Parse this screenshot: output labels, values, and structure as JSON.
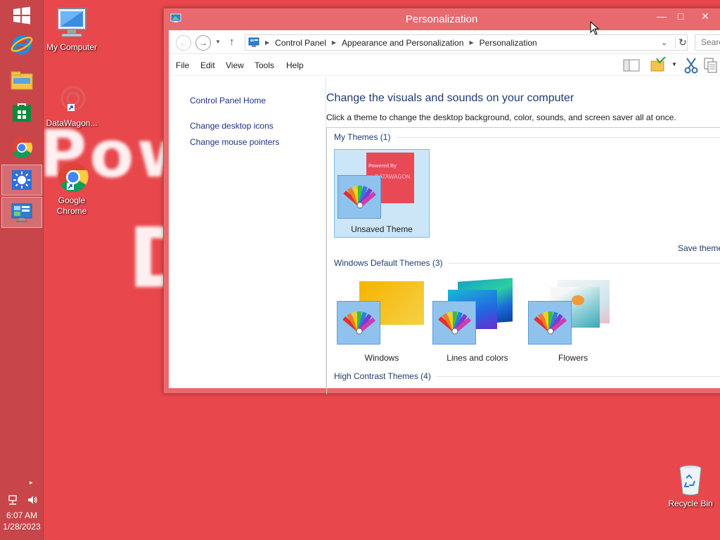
{
  "window": {
    "title": "Personalization",
    "minimize_glyph": "—",
    "maximize_glyph": "□",
    "close_glyph": "✕"
  },
  "address": {
    "crumbs": [
      "Control Panel",
      "Appearance and Personalization",
      "Personalization"
    ],
    "search_placeholder": "Search"
  },
  "menu": [
    "File",
    "Edit",
    "View",
    "Tools",
    "Help"
  ],
  "left_pane": {
    "home": "Control Panel Home",
    "links": [
      "Change desktop icons",
      "Change mouse pointers"
    ]
  },
  "main": {
    "heading": "Change the visuals and sounds on your computer",
    "subtext": "Click a theme to change the desktop background, color, sounds, and screen saver all at once.",
    "groups": [
      {
        "title": "My Themes (1)"
      },
      {
        "title": "Windows Default Themes (3)"
      },
      {
        "title": "High Contrast Themes (4)"
      }
    ],
    "my_theme": {
      "name": "Unsaved Theme",
      "preview_line1": "Powered By",
      "preview_line2": "DATAWAGON",
      "preview_color": "#e84a55"
    },
    "default_themes": [
      "Windows",
      "Lines and colors",
      "Flowers"
    ],
    "save_theme": "Save theme"
  },
  "desktop": {
    "icons": [
      "My Computer",
      "DataWagon...",
      "Google Chrome"
    ],
    "recycle_bin": "Recycle Bin",
    "watermark_1": "Pow",
    "watermark_2": "D"
  },
  "taskbar": {
    "time": "6:07 AM",
    "date": "1/28/2023",
    "tray_arrow": "▸"
  },
  "colors": {
    "desktop_bg": "#e8474c",
    "accent": "#1e3c72",
    "link": "#1e3287",
    "selection": "#cde6f7"
  }
}
